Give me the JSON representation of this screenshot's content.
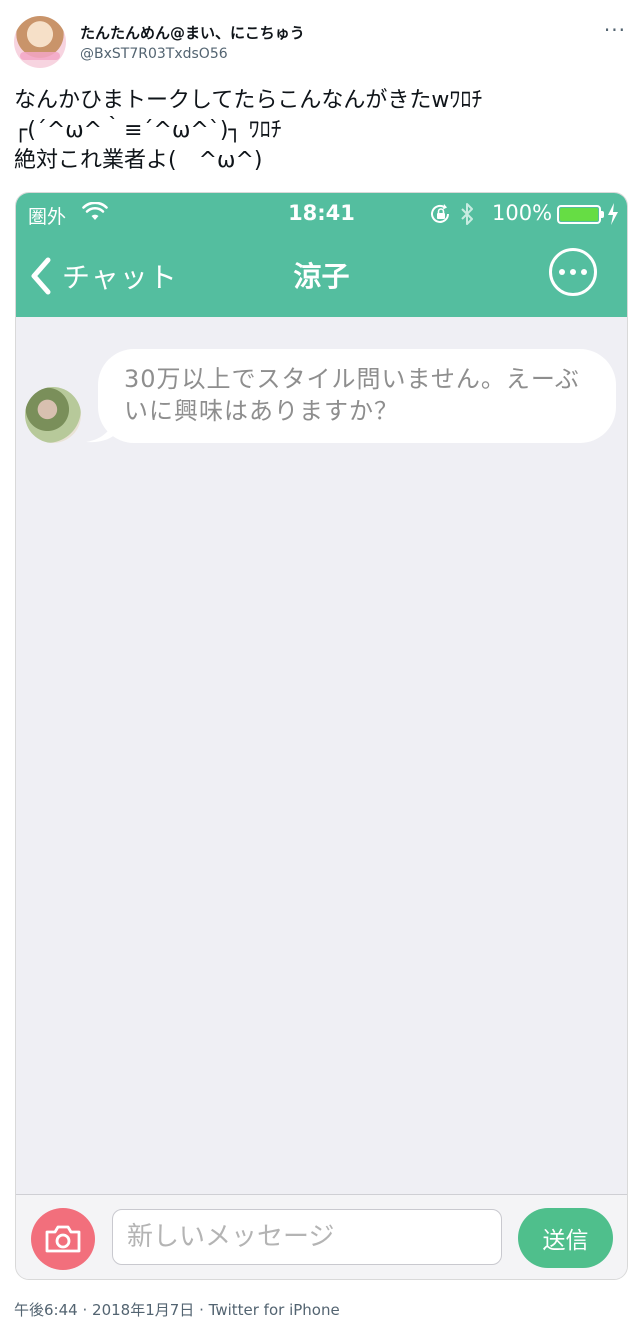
{
  "tweet": {
    "display_name": "たんたんめん@まい、にこちゅう",
    "handle": "@BxST7R03TxdsO56",
    "more_icon": "more-horizontal-icon",
    "text_lines": [
      "なんかひまトークしてたらこんなんがきたwﾜﾛﾁ",
      "┌(´^ω^｀≡´^ω^`)┐ ﾜﾛﾁ",
      "絶対これ業者よ(　^ω^)"
    ],
    "meta": {
      "time": "午後6:44",
      "date": "2018年1月7日",
      "source": "Twitter for iPhone",
      "separator": "·"
    }
  },
  "screenshot": {
    "status_bar": {
      "carrier": "圏外",
      "time": "18:41",
      "battery_percent": "100%",
      "battery_level": 1.0,
      "icons": [
        "wifi-icon",
        "rotation-lock-icon",
        "bluetooth-icon",
        "battery-icon",
        "charging-icon"
      ]
    },
    "nav": {
      "back_label": "チャット",
      "title": "涼子",
      "more_icon": "more-circle-icon"
    },
    "chat": {
      "messages": [
        {
          "sender": "涼子",
          "text": "30万以上でスタイル問いません。えーぶいに興味はありますか？"
        }
      ]
    },
    "composer": {
      "placeholder": "新しいメッセージ",
      "value": "",
      "send_label": "送信",
      "camera_icon": "camera-icon"
    },
    "colors": {
      "header_green": "#54be9f",
      "send_green": "#4fbf8c",
      "camera_red": "#f26f7c",
      "chat_background": "#efeff4",
      "battery_green": "#66dd44"
    }
  }
}
